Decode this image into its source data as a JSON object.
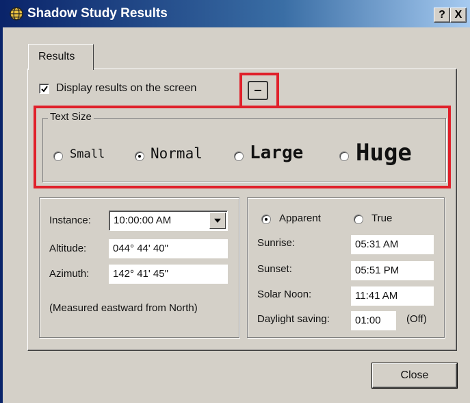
{
  "window": {
    "title": "Shadow Study Results",
    "help_button": "?",
    "close_button": "X"
  },
  "tabs": [
    {
      "label": "Results"
    }
  ],
  "display": {
    "label": "Display results on the screen",
    "checked": true
  },
  "text_size": {
    "legend": "Text Size",
    "options": [
      {
        "label": "Small",
        "selected": false
      },
      {
        "label": "Normal",
        "selected": true
      },
      {
        "label": "Large",
        "selected": false
      },
      {
        "label": "Huge",
        "selected": false
      }
    ]
  },
  "left": {
    "instance_label": "Instance:",
    "instance_value": "10:00:00 AM",
    "altitude_label": "Altitude:",
    "altitude_value": "044° 44' 40\"",
    "azimuth_label": "Azimuth:",
    "azimuth_value": "142° 41' 45\"",
    "note": "(Measured eastward from North)"
  },
  "right": {
    "apparent_label": "Apparent",
    "true_label": "True",
    "mode_selected": "Apparent",
    "sunrise_label": "Sunrise:",
    "sunrise_value": "05:31 AM",
    "sunset_label": "Sunset:",
    "sunset_value": "05:51 PM",
    "solar_noon_label": "Solar Noon:",
    "solar_noon_value": "11:41 AM",
    "daylight_label": "Daylight saving:",
    "daylight_value": "01:00",
    "daylight_state": "(Off)"
  },
  "footer": {
    "close_label": "Close"
  },
  "colors": {
    "highlight": "#e0202a",
    "title_bar": "#0a246a",
    "face": "#d4d0c8"
  }
}
